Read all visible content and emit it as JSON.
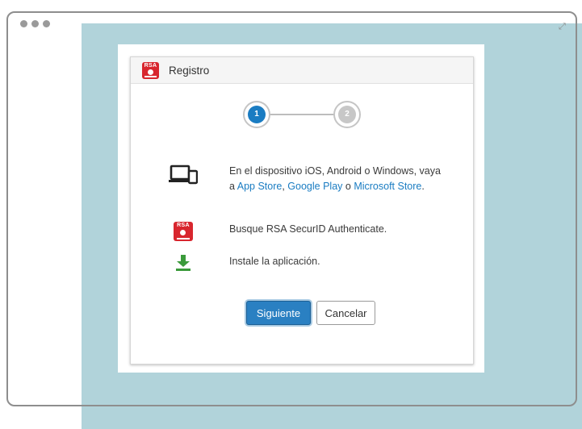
{
  "dialog": {
    "title": "Registro",
    "logo_text": "RSA"
  },
  "stepper": {
    "steps": [
      {
        "number": "1",
        "state": "active"
      },
      {
        "number": "2",
        "state": "inactive"
      }
    ]
  },
  "instructions": {
    "step1": {
      "text_before": "En el dispositivo iOS, Android o Windows, vaya a ",
      "app_store": "App Store",
      "sep1": ", ",
      "google_play": "Google Play",
      "sep2": " o ",
      "microsoft_store": "Microsoft Store",
      "text_after": "."
    },
    "step2": "Busque RSA SecurID Authenticate.",
    "step3": "Instale la aplicación."
  },
  "buttons": {
    "next": "Siguiente",
    "cancel": "Cancelar"
  },
  "colors": {
    "accent": "#1a7cc2",
    "rsa_red": "#d8262e",
    "download_green": "#3b9a3b",
    "background_block": "#b1d3da"
  },
  "icons": {
    "devices": "devices-icon",
    "rsa": "rsa-logo-icon",
    "download": "download-icon",
    "expand": "expand-icon"
  }
}
